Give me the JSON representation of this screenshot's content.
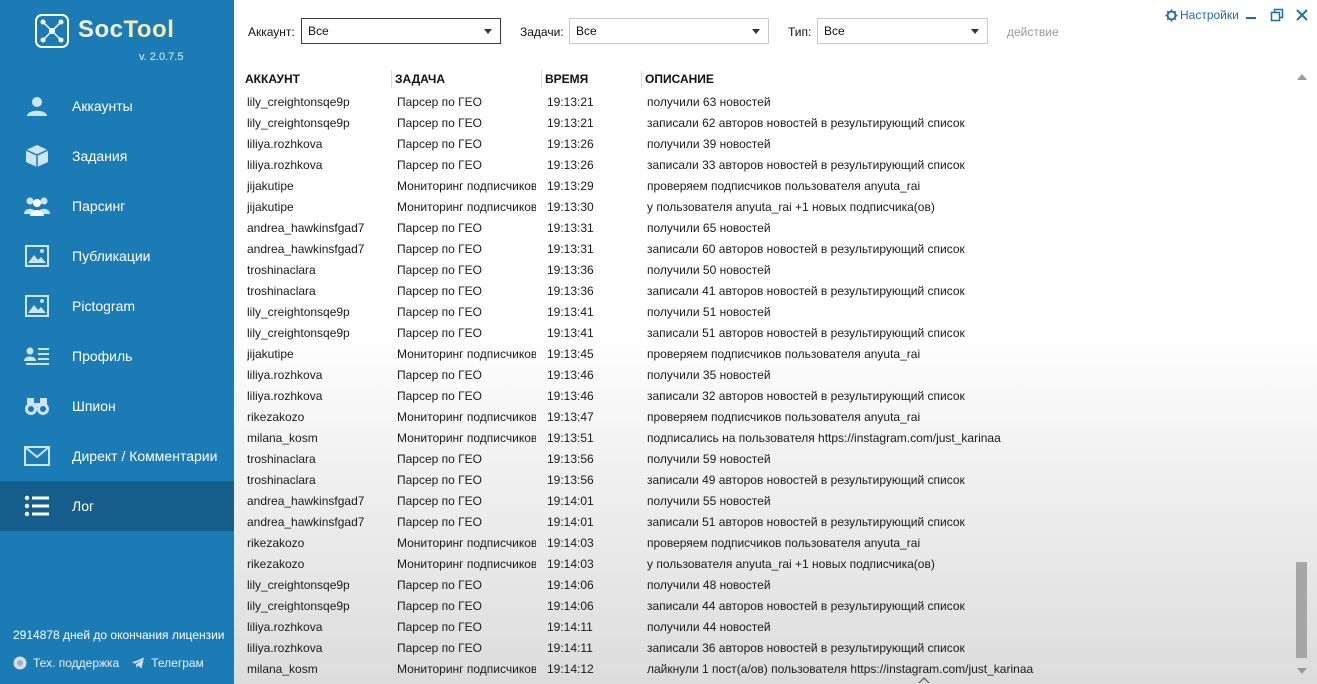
{
  "app": {
    "name_part1": "Soc",
    "name_part2": "Tool",
    "version": "v. 2.0.7.5"
  },
  "sidebar": {
    "items": [
      {
        "label": "Аккаунты",
        "icon": "user-icon"
      },
      {
        "label": "Задания",
        "icon": "box-icon"
      },
      {
        "label": "Парсинг",
        "icon": "users-group-icon"
      },
      {
        "label": "Публикации",
        "icon": "image-icon"
      },
      {
        "label": "Pictogram",
        "icon": "image-icon"
      },
      {
        "label": "Профиль",
        "icon": "profile-list-icon"
      },
      {
        "label": "Шпион",
        "icon": "binoculars-icon"
      },
      {
        "label": "Директ / Комментарии",
        "icon": "envelope-icon"
      },
      {
        "label": "Лог",
        "icon": "list-icon",
        "active": true
      }
    ],
    "license_text": "2914878 дней до окончания лицензии",
    "support_label": "Тех. поддержка",
    "telegram_label": "Телеграм"
  },
  "filters": {
    "account_label": "Аккаунт:",
    "account_value": "Все",
    "tasks_label": "Задачи:",
    "tasks_value": "Все",
    "type_label": "Тип:",
    "type_value": "Все",
    "action_label": "действие"
  },
  "window": {
    "settings_label": "Настройки"
  },
  "table": {
    "headers": [
      "АККАУНТ",
      "ЗАДАЧА",
      "ВРЕМЯ",
      "ОПИСАНИЕ"
    ],
    "rows": [
      [
        "lily_creightonsqe9p",
        "Парсер по ГЕО",
        "19:13:21",
        "получили 63 новостей"
      ],
      [
        "lily_creightonsqe9p",
        "Парсер по ГЕО",
        "19:13:21",
        "записали 62 авторов новостей в результирующий список"
      ],
      [
        "liliya.rozhkova",
        "Парсер по ГЕО",
        "19:13:26",
        "получили 39 новостей"
      ],
      [
        "liliya.rozhkova",
        "Парсер по ГЕО",
        "19:13:26",
        "записали 33 авторов новостей в результирующий список"
      ],
      [
        "jijakutipe",
        "Мониторинг подписчиков",
        "19:13:29",
        "проверяем подписчиков пользователя anyuta_rai"
      ],
      [
        "jijakutipe",
        "Мониторинг подписчиков",
        "19:13:30",
        "у пользователя anyuta_rai  +1 новых подписчика(ов)"
      ],
      [
        "andrea_hawkinsfgad7",
        "Парсер по ГЕО",
        "19:13:31",
        "получили 65 новостей"
      ],
      [
        "andrea_hawkinsfgad7",
        "Парсер по ГЕО",
        "19:13:31",
        "записали 60 авторов новостей в результирующий список"
      ],
      [
        "troshinaclara",
        "Парсер по ГЕО",
        "19:13:36",
        "получили 50 новостей"
      ],
      [
        "troshinaclara",
        "Парсер по ГЕО",
        "19:13:36",
        "записали 41 авторов новостей в результирующий список"
      ],
      [
        "lily_creightonsqe9p",
        "Парсер по ГЕО",
        "19:13:41",
        "получили 51 новостей"
      ],
      [
        "lily_creightonsqe9p",
        "Парсер по ГЕО",
        "19:13:41",
        "записали 51 авторов новостей в результирующий список"
      ],
      [
        "jijakutipe",
        "Мониторинг подписчиков",
        "19:13:45",
        "проверяем подписчиков пользователя anyuta_rai"
      ],
      [
        "liliya.rozhkova",
        "Парсер по ГЕО",
        "19:13:46",
        "получили 35 новостей"
      ],
      [
        "liliya.rozhkova",
        "Парсер по ГЕО",
        "19:13:46",
        "записали 32 авторов новостей в результирующий список"
      ],
      [
        "rikezakozo",
        "Мониторинг подписчиков",
        "19:13:47",
        "проверяем подписчиков пользователя anyuta_rai"
      ],
      [
        "milana_kosm",
        "Мониторинг подписчиков",
        "19:13:51",
        "подписались на пользователя https://instagram.com/just_karinaa"
      ],
      [
        "troshinaclara",
        "Парсер по ГЕО",
        "19:13:56",
        "получили 59 новостей"
      ],
      [
        "troshinaclara",
        "Парсер по ГЕО",
        "19:13:56",
        "записали 49 авторов новостей в результирующий список"
      ],
      [
        "andrea_hawkinsfgad7",
        "Парсер по ГЕО",
        "19:14:01",
        "получили 55 новостей"
      ],
      [
        "andrea_hawkinsfgad7",
        "Парсер по ГЕО",
        "19:14:01",
        "записали 51 авторов новостей в результирующий список"
      ],
      [
        "rikezakozo",
        "Мониторинг подписчиков",
        "19:14:03",
        "проверяем подписчиков пользователя anyuta_rai"
      ],
      [
        "rikezakozo",
        "Мониторинг подписчиков",
        "19:14:03",
        "у пользователя anyuta_rai  +1 новых подписчика(ов)"
      ],
      [
        "lily_creightonsqe9p",
        "Парсер по ГЕО",
        "19:14:06",
        "получили 48 новостей"
      ],
      [
        "lily_creightonsqe9p",
        "Парсер по ГЕО",
        "19:14:06",
        "записали 44 авторов новостей в результирующий список"
      ],
      [
        "liliya.rozhkova",
        "Парсер по ГЕО",
        "19:14:11",
        "получили 44 новостей"
      ],
      [
        "liliya.rozhkova",
        "Парсер по ГЕО",
        "19:14:11",
        "записали 36 авторов новостей в результирующий список"
      ],
      [
        "milana_kosm",
        "Мониторинг подписчиков",
        "19:14:12",
        "лайкнули 1 пост(а/ов) пользователя https://instagram.com/just_karinaa"
      ]
    ]
  },
  "colors": {
    "sidebar_bg": "#1b7bb5",
    "sidebar_active": "#155e8c",
    "accent_link": "#1f6fa5"
  }
}
